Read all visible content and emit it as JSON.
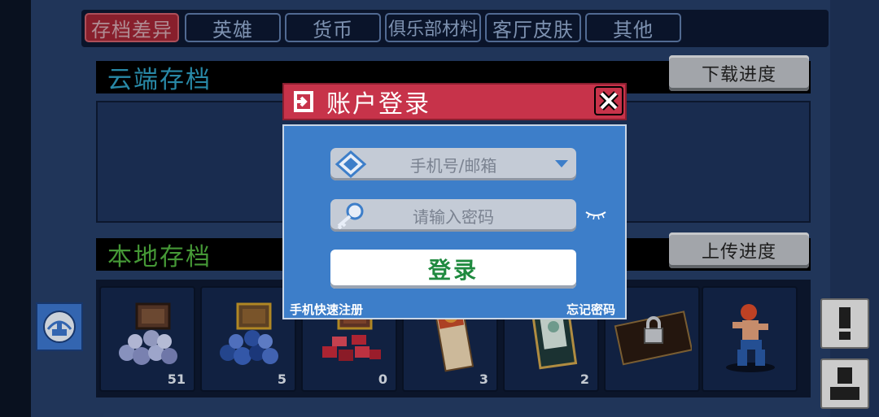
{
  "tabs": [
    {
      "label": "存档差异",
      "active": true
    },
    {
      "label": "英雄",
      "active": false
    },
    {
      "label": "货币",
      "active": false
    },
    {
      "label": "俱乐部材料",
      "active": false
    },
    {
      "label": "客厅皮肤",
      "active": false
    },
    {
      "label": "其他",
      "active": false
    }
  ],
  "cloud": {
    "title": "云端存档",
    "button": "下载进度"
  },
  "local": {
    "title": "本地存档",
    "button": "上传进度",
    "items": [
      {
        "icon": "silver-gem-chest-icon",
        "count": "51"
      },
      {
        "icon": "gold-gem-chest-icon",
        "count": "5"
      },
      {
        "icon": "red-gem-chest-icon",
        "count": "0"
      },
      {
        "icon": "ticket-icon",
        "count": "3"
      },
      {
        "icon": "tarot-card-icon",
        "count": "2"
      },
      {
        "icon": "locked-scroll-icon",
        "count": ""
      },
      {
        "icon": "hero-fighter-icon",
        "count": ""
      }
    ]
  },
  "dialog": {
    "title": "账户登录",
    "account_placeholder": "手机号/邮箱",
    "password_placeholder": "请输入密码",
    "login_button": "登录",
    "register_link": "手机快速注册",
    "forgot_link": "忘记密码"
  },
  "colors": {
    "accent_red": "#c7334a",
    "dialog_blue": "#3d7ec9",
    "cloud_title": "#2e9bbd",
    "local_title": "#4fae3e",
    "login_text": "#1f8a3f"
  }
}
